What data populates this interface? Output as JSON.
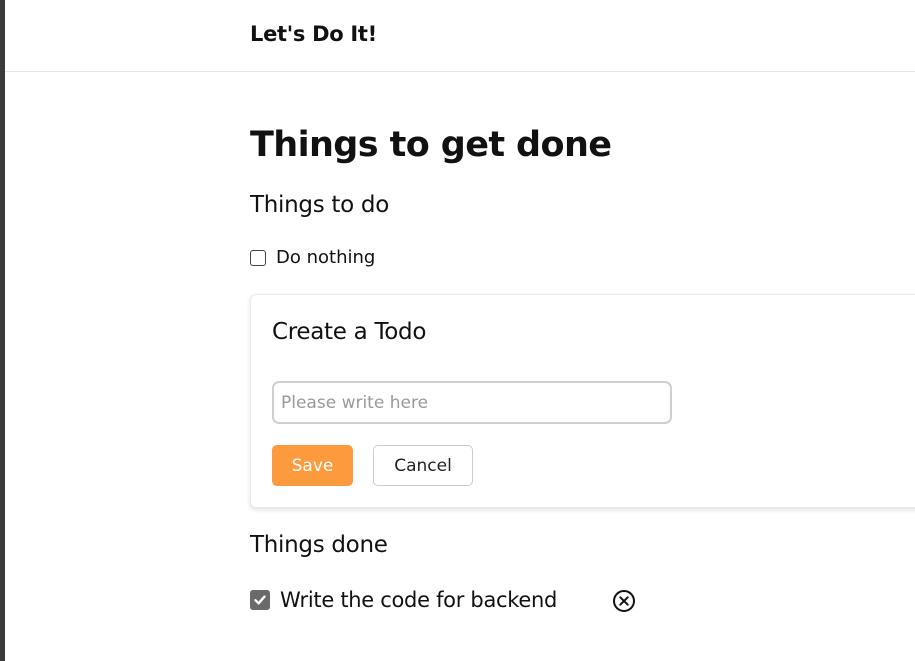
{
  "navbar": {
    "brand": "Let's Do It!"
  },
  "main": {
    "title": "Things to get done",
    "todo_section": {
      "heading": "Things to do",
      "items": [
        {
          "label": "Do nothing",
          "checked": false
        }
      ]
    },
    "create_form": {
      "title": "Create a Todo",
      "input_placeholder": "Please write here",
      "input_value": "",
      "save_label": "Save",
      "cancel_label": "Cancel"
    },
    "done_section": {
      "heading": "Things done",
      "items": [
        {
          "label": "Write the code for backend",
          "checked": true
        }
      ]
    }
  },
  "colors": {
    "accent": "#fd9a3e",
    "checked_box": "#6a6a6a",
    "divider": "#e6e6e6"
  },
  "icons": {
    "checkbox_checked": "check-icon",
    "delete": "close-circle-icon"
  }
}
